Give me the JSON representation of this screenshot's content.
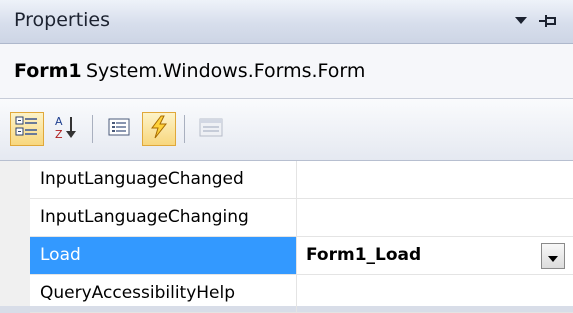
{
  "window": {
    "title": "Properties"
  },
  "object": {
    "name": "Form1",
    "type": "System.Windows.Forms.Form"
  },
  "toolbar": {
    "buttons": [
      {
        "icon": "categorized-icon",
        "checked": true
      },
      {
        "icon": "alphabetical-sort-icon",
        "checked": false
      },
      {
        "icon": "properties-icon",
        "checked": false
      },
      {
        "icon": "events-lightning-icon",
        "checked": true
      },
      {
        "icon": "property-pages-icon",
        "checked": false,
        "disabled": true
      }
    ]
  },
  "grid": {
    "rows": [
      {
        "name": "InputLanguageChanged",
        "value": ""
      },
      {
        "name": "InputLanguageChanging",
        "value": ""
      },
      {
        "name": "Load",
        "value": "Form1_Load",
        "selected": true
      },
      {
        "name": "QueryAccessibilityHelp",
        "value": ""
      }
    ]
  },
  "colors": {
    "selection": "#3399ff",
    "checked_button": "#f8d77e"
  }
}
